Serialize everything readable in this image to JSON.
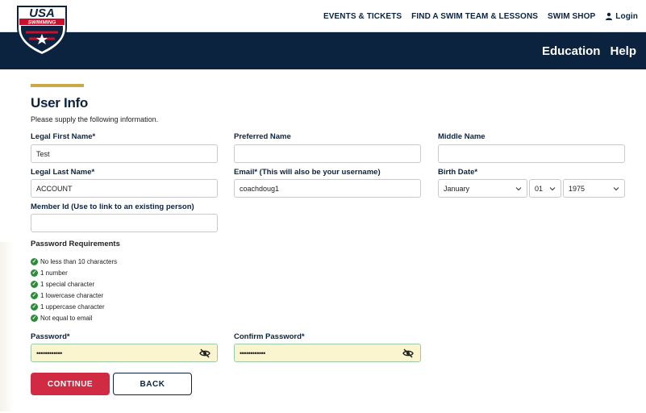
{
  "header": {
    "logo_text_top": "USA",
    "logo_text_bottom": "SWIMMING",
    "top_links": [
      "EVENTS & TICKETS",
      "FIND A SWIM TEAM & LESSONS",
      "SWIM SHOP"
    ],
    "login_label": "Login",
    "main_links": [
      "Education",
      "Help"
    ]
  },
  "page": {
    "title": "User Info",
    "subtitle": "Please supply the following information."
  },
  "form": {
    "legal_first_name": {
      "label": "Legal First Name*",
      "value": "Test"
    },
    "preferred_name": {
      "label": "Preferred Name",
      "value": ""
    },
    "middle_name": {
      "label": "Middle Name",
      "value": ""
    },
    "legal_last_name": {
      "label": "Legal Last Name*",
      "value": "ACCOUNT"
    },
    "email": {
      "label": "Email* (This will also be your username)",
      "value": "coachdoug1"
    },
    "birth_date": {
      "label": "Birth Date*",
      "month": "January",
      "day": "01",
      "year": "1975"
    },
    "member_id": {
      "label": "Member Id (Use to link to an existing person)",
      "value": ""
    },
    "password": {
      "label": "Password*",
      "value": "••••••••••••"
    },
    "confirm_password": {
      "label": "Confirm Password*",
      "value": "••••••••••••"
    }
  },
  "password_requirements": {
    "title": "Password Requirements",
    "items": [
      "No less than 10 characters",
      "1 number",
      "1 special character",
      "1 lowercase character",
      "1 uppercase character",
      "Not equal to email"
    ]
  },
  "buttons": {
    "continue": "CONTINUE",
    "back": "BACK"
  },
  "colors": {
    "navy": "#0c2340",
    "gold_accent": "#c9a94b",
    "continue_red": "#d12a43",
    "check_green": "#2e8b3a",
    "password_fill": "#fbf5cf"
  },
  "icons": {
    "login": "person-icon",
    "requirement": "check-circle-icon",
    "password_toggle": "eye-slash-icon",
    "select": "chevron-down-icon"
  }
}
